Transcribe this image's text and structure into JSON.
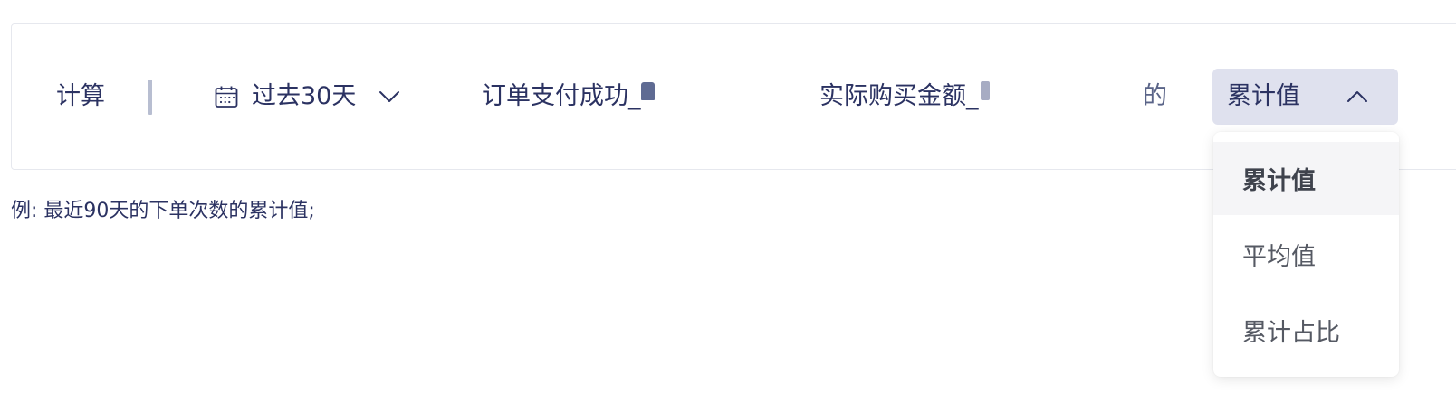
{
  "rule": {
    "calc_label": "计算",
    "date_range": {
      "value": "过去30天",
      "icon": "calendar-icon"
    },
    "event": {
      "value": "订单支付成功_"
    },
    "property": {
      "value": "实际购买金额_"
    },
    "of_label": "的",
    "aggregation": {
      "value": "累计值"
    }
  },
  "hint": "例: 最近90天的下单次数的累计值;",
  "dropdown": {
    "options": [
      {
        "label": "累计值",
        "selected": true
      },
      {
        "label": "平均值",
        "selected": false
      },
      {
        "label": "累计占比",
        "selected": false
      }
    ]
  },
  "colors": {
    "text": "#2b3262",
    "select_bg": "#dfe1ee",
    "divider": "#b8bed1",
    "selected_option_bg": "#f5f5f7"
  }
}
